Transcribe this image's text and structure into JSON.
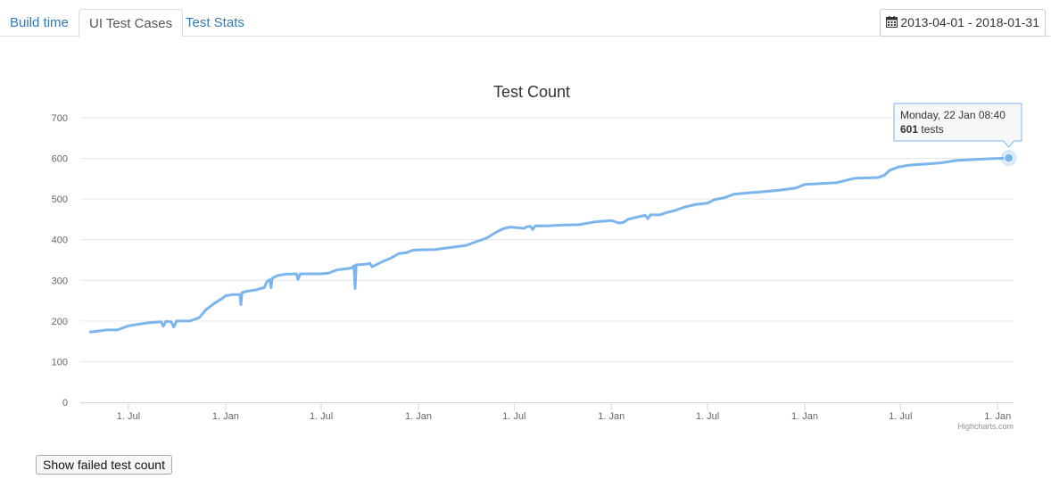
{
  "tabs": [
    {
      "label": "Build time",
      "active": false
    },
    {
      "label": "UI Test Cases",
      "active": true
    },
    {
      "label": "Test Stats",
      "active": false
    }
  ],
  "date_range": {
    "icon": "calendar-icon",
    "label": "2013-04-01 - 2018-01-31"
  },
  "button_failed": "Show failed test count",
  "colors": {
    "series": "#7cb5ec",
    "link": "#337ab7",
    "grid": "#e6e6e6"
  },
  "chart_data": {
    "type": "line",
    "title": "Test Count",
    "xlabel": "",
    "ylabel": "",
    "ylim": [
      0,
      700
    ],
    "yticks": [
      "0",
      "100",
      "200",
      "300",
      "400",
      "500",
      "600",
      "700"
    ],
    "xlim": [
      "2013-04-01",
      "2018-01-31"
    ],
    "xticks": [
      {
        "date": "2013-07-01",
        "label": "1. Jul"
      },
      {
        "date": "2014-01-01",
        "label": "1. Jan"
      },
      {
        "date": "2014-07-01",
        "label": "1. Jul"
      },
      {
        "date": "2015-01-01",
        "label": "1. Jan"
      },
      {
        "date": "2015-07-01",
        "label": "1. Jul"
      },
      {
        "date": "2016-01-01",
        "label": "1. Jan"
      },
      {
        "date": "2016-07-01",
        "label": "1. Jul"
      },
      {
        "date": "2017-01-01",
        "label": "1. Jan"
      },
      {
        "date": "2017-07-01",
        "label": "1. Jul"
      },
      {
        "date": "2018-01-01",
        "label": "1. Jan"
      }
    ],
    "grid": true,
    "legend": "none",
    "credits": "Highcharts.com",
    "series": [
      {
        "color": "#7cb5ec",
        "points": [
          [
            "2013-04-20",
            173
          ],
          [
            "2013-05-10",
            176
          ],
          [
            "2013-05-20",
            178
          ],
          [
            "2013-06-10",
            178
          ],
          [
            "2013-07-01",
            188
          ],
          [
            "2013-07-20",
            192
          ],
          [
            "2013-08-10",
            196
          ],
          [
            "2013-09-01",
            198
          ],
          [
            "2013-09-05",
            187
          ],
          [
            "2013-09-10",
            199
          ],
          [
            "2013-09-20",
            198
          ],
          [
            "2013-09-25",
            185
          ],
          [
            "2013-09-30",
            200
          ],
          [
            "2013-10-25",
            200
          ],
          [
            "2013-11-01",
            203
          ],
          [
            "2013-11-12",
            208
          ],
          [
            "2013-11-25",
            228
          ],
          [
            "2013-12-10",
            243
          ],
          [
            "2013-12-25",
            255
          ],
          [
            "2014-01-01",
            262
          ],
          [
            "2014-01-15",
            265
          ],
          [
            "2014-01-28",
            265
          ],
          [
            "2014-01-30",
            240
          ],
          [
            "2014-02-01",
            270
          ],
          [
            "2014-02-10",
            273
          ],
          [
            "2014-03-01",
            277
          ],
          [
            "2014-03-05",
            279
          ],
          [
            "2014-03-15",
            282
          ],
          [
            "2014-03-20",
            297
          ],
          [
            "2014-03-26",
            302
          ],
          [
            "2014-03-28",
            282
          ],
          [
            "2014-03-30",
            305
          ],
          [
            "2014-04-10",
            312
          ],
          [
            "2014-04-25",
            315
          ],
          [
            "2014-05-15",
            316
          ],
          [
            "2014-05-18",
            302
          ],
          [
            "2014-05-22",
            316
          ],
          [
            "2014-06-10",
            316
          ],
          [
            "2014-07-01",
            316
          ],
          [
            "2014-07-15",
            318
          ],
          [
            "2014-08-01",
            326
          ],
          [
            "2014-08-20",
            329
          ],
          [
            "2014-08-28",
            331
          ],
          [
            "2014-09-01",
            336
          ],
          [
            "2014-09-03",
            280
          ],
          [
            "2014-09-05",
            338
          ],
          [
            "2014-09-25",
            340
          ],
          [
            "2014-10-01",
            342
          ],
          [
            "2014-10-05",
            333
          ],
          [
            "2014-10-12",
            338
          ],
          [
            "2014-10-25",
            346
          ],
          [
            "2014-11-10",
            355
          ],
          [
            "2014-11-25",
            366
          ],
          [
            "2014-12-10",
            368
          ],
          [
            "2014-12-20",
            374
          ],
          [
            "2015-01-01",
            375
          ],
          [
            "2015-02-01",
            376
          ],
          [
            "2015-02-20",
            379
          ],
          [
            "2015-03-10",
            382
          ],
          [
            "2015-04-01",
            386
          ],
          [
            "2015-04-20",
            395
          ],
          [
            "2015-05-10",
            404
          ],
          [
            "2015-05-25",
            416
          ],
          [
            "2015-06-05",
            424
          ],
          [
            "2015-06-15",
            429
          ],
          [
            "2015-06-25",
            431
          ],
          [
            "2015-07-10",
            429
          ],
          [
            "2015-07-20",
            428
          ],
          [
            "2015-07-25",
            432
          ],
          [
            "2015-08-01",
            433
          ],
          [
            "2015-08-05",
            425
          ],
          [
            "2015-08-10",
            434
          ],
          [
            "2015-09-01",
            434
          ],
          [
            "2015-10-01",
            436
          ],
          [
            "2015-11-01",
            437
          ],
          [
            "2015-12-01",
            444
          ],
          [
            "2016-01-01",
            447
          ],
          [
            "2016-01-15",
            441
          ],
          [
            "2016-01-25",
            443
          ],
          [
            "2016-02-01",
            450
          ],
          [
            "2016-02-20",
            456
          ],
          [
            "2016-03-05",
            460
          ],
          [
            "2016-03-10",
            452
          ],
          [
            "2016-03-15",
            461
          ],
          [
            "2016-04-01",
            461
          ],
          [
            "2016-04-15",
            467
          ],
          [
            "2016-05-01",
            472
          ],
          [
            "2016-05-20",
            481
          ],
          [
            "2016-06-10",
            487
          ],
          [
            "2016-07-01",
            490
          ],
          [
            "2016-07-15",
            499
          ],
          [
            "2016-08-01",
            503
          ],
          [
            "2016-08-20",
            512
          ],
          [
            "2016-09-15",
            515
          ],
          [
            "2016-10-15",
            518
          ],
          [
            "2016-11-15",
            522
          ],
          [
            "2016-12-15",
            527
          ],
          [
            "2017-01-01",
            536
          ],
          [
            "2017-02-01",
            538
          ],
          [
            "2017-03-01",
            540
          ],
          [
            "2017-03-20",
            546
          ],
          [
            "2017-04-05",
            551
          ],
          [
            "2017-05-20",
            553
          ],
          [
            "2017-06-01",
            559
          ],
          [
            "2017-06-10",
            570
          ],
          [
            "2017-06-25",
            578
          ],
          [
            "2017-07-15",
            583
          ],
          [
            "2017-08-15",
            586
          ],
          [
            "2017-09-15",
            589
          ],
          [
            "2017-10-15",
            595
          ],
          [
            "2017-11-15",
            597
          ],
          [
            "2017-12-15",
            599
          ],
          [
            "2018-01-22",
            601
          ]
        ]
      }
    ],
    "tooltip": {
      "date_text": "Monday, 22 Jan 08:40",
      "value": "601",
      "unit": "tests",
      "date": "2018-01-22",
      "y": 601
    }
  }
}
